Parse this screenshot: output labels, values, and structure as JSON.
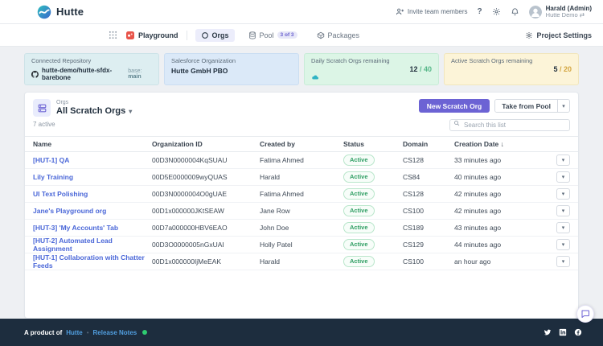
{
  "topbar": {
    "app_name": "Hutte",
    "invite_button": "Invite team members",
    "user_name": "Harald (Admin)",
    "user_org": "Hutte Demo"
  },
  "navbar": {
    "playground": "Playground",
    "tabs": [
      {
        "label": "Orgs"
      },
      {
        "label": "Pool",
        "badge": "3 of 3"
      },
      {
        "label": "Packages"
      }
    ],
    "project_settings": "Project Settings"
  },
  "cards": {
    "repo": {
      "title": "Connected Repository",
      "name": "hutte-demo/hutte-sfdx-barebone",
      "meta_label": "base:",
      "meta_value": "main"
    },
    "salesforce": {
      "title": "Salesforce Organization",
      "name": "Hutte GmbH PBO"
    },
    "daily": {
      "title": "Daily Scratch Orgs remaining",
      "value": "12",
      "total": "/ 40"
    },
    "active": {
      "title": "Active Scratch Orgs remaining",
      "value": "5",
      "total": "/ 20"
    }
  },
  "panel": {
    "kicker": "Orgs",
    "title": "All Scratch Orgs",
    "subtitle": "7 active",
    "new_button": "New Scratch Org",
    "pool_button": "Take from Pool",
    "search_placeholder": "Search this list"
  },
  "table": {
    "columns": [
      "Name",
      "Organization ID",
      "Created by",
      "Status",
      "Domain",
      "Creation Date ↓"
    ],
    "rows": [
      {
        "name": "[HUT-1] QA",
        "org_id": "00D3N0000004KqSUAU",
        "created_by": "Fatima Ahmed",
        "status": "Active",
        "domain": "CS128",
        "creation_date": "33 minutes ago"
      },
      {
        "name": "Lily Training",
        "org_id": "00D5E0000009wyQUAS",
        "created_by": "Harald",
        "status": "Active",
        "domain": "CS84",
        "creation_date": "40 minutes ago"
      },
      {
        "name": "UI Text Polishing",
        "org_id": "00D3N0000004O0gUAE",
        "created_by": "Fatima Ahmed",
        "status": "Active",
        "domain": "CS128",
        "creation_date": "42 minutes ago"
      },
      {
        "name": "Jane's Playground org",
        "org_id": "00D1x000000JKtSEAW",
        "created_by": "Jane Row",
        "status": "Active",
        "domain": "CS100",
        "creation_date": "42 minutes ago"
      },
      {
        "name": "[HUT-3] 'My Accounts' Tab",
        "org_id": "00D7a000000HBV6EAO",
        "created_by": "John Doe",
        "status": "Active",
        "domain": "CS189",
        "creation_date": "43 minutes ago"
      },
      {
        "name": "[HUT-2] Automated Lead Assignment",
        "org_id": "00D3O0000005nGxUAI",
        "created_by": "Holly Patel",
        "status": "Active",
        "domain": "CS129",
        "creation_date": "44 minutes ago"
      },
      {
        "name": "[HUT-1] Collaboration with Chatter Feeds",
        "org_id": "00D1x000000IjMeEAK",
        "created_by": "Harald",
        "status": "Active",
        "domain": "CS100",
        "creation_date": "an hour ago"
      }
    ]
  },
  "footer": {
    "prefix": "A product of",
    "brand_link": "Hutte",
    "separator": "•",
    "release_notes": "Release Notes"
  }
}
